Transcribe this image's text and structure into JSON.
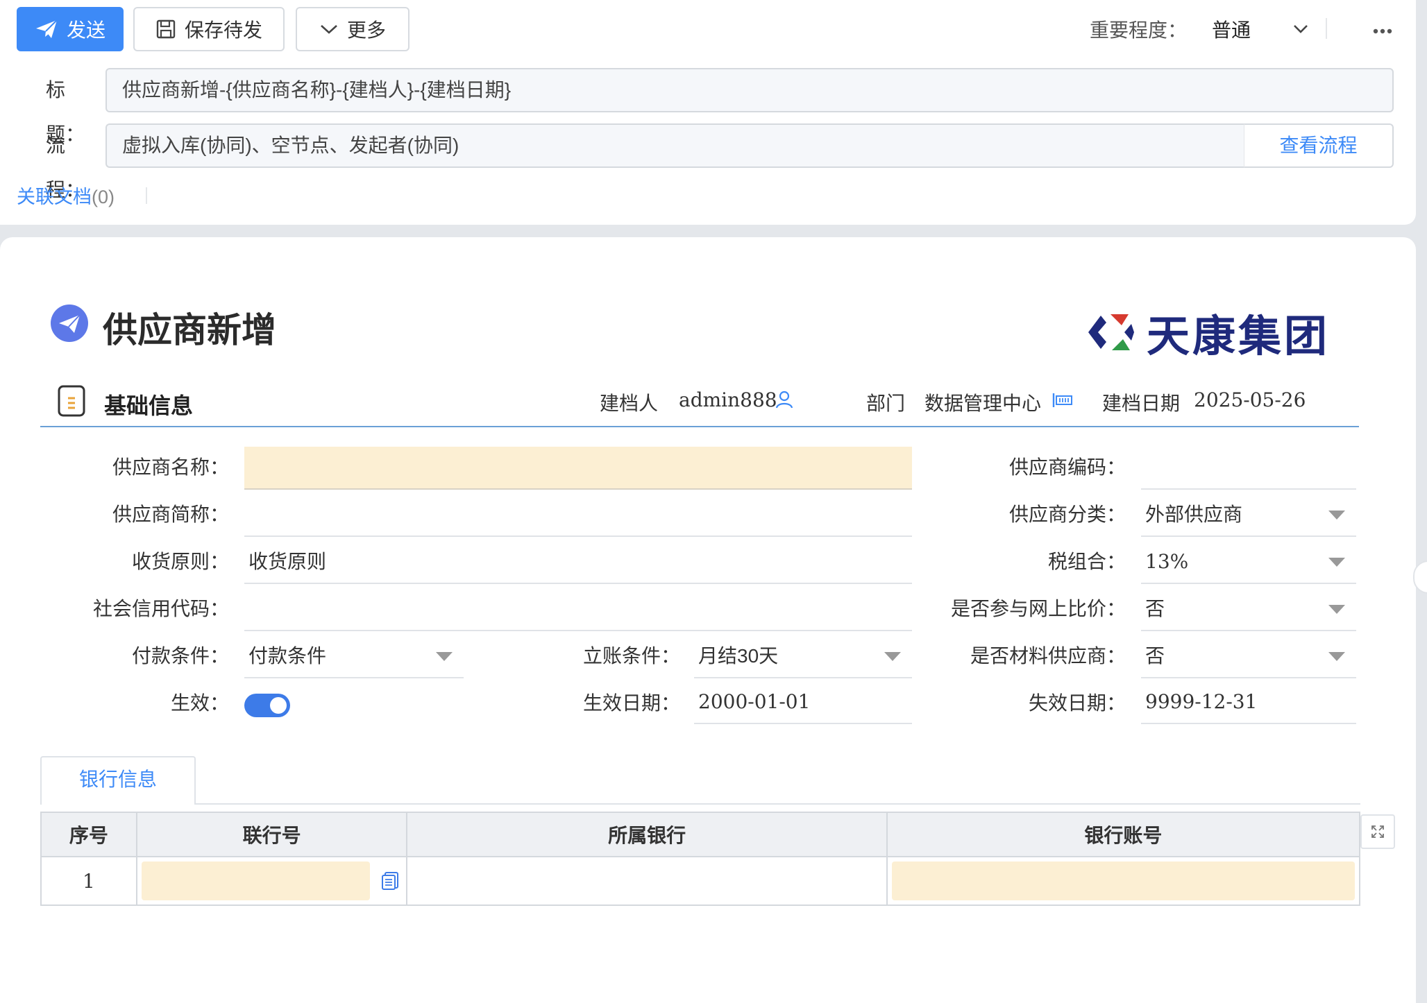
{
  "toolbar": {
    "send_label": "发送",
    "save_label": "保存待发",
    "more_label": "更多",
    "importance_label": "重要程度：",
    "importance_value": "普通"
  },
  "header": {
    "title_label": "标题：",
    "title_value": "供应商新增-{供应商名称}-{建档人}-{建档日期}",
    "flow_label": "流程：",
    "flow_value": "虚拟入库(协同)、空节点、发起者(协同)",
    "view_flow_label": "查看流程",
    "related_docs_label": "关联文档",
    "related_docs_count": "(0)"
  },
  "form": {
    "title": "供应商新增",
    "brand": "天康集团",
    "section_title": "基础信息",
    "meta": {
      "creator_label": "建档人",
      "creator_value": "admin888",
      "dept_label": "部门",
      "dept_value": "数据管理中心",
      "date_label": "建档日期",
      "date_value": "2025-05-26"
    },
    "fields": {
      "supplier_name_label": "供应商名称：",
      "supplier_name_value": "",
      "supplier_code_label": "供应商编码：",
      "supplier_code_value": "",
      "supplier_short_label": "供应商简称：",
      "supplier_short_value": "",
      "supplier_category_label": "供应商分类：",
      "supplier_category_value": "外部供应商",
      "receipt_rule_label": "收货原则：",
      "receipt_rule_value": "收货原则",
      "tax_group_label": "税组合：",
      "tax_group_value": "13%",
      "credit_code_label": "社会信用代码：",
      "credit_code_value": "",
      "online_bid_label": "是否参与网上比价：",
      "online_bid_value": "否",
      "payment_terms_label": "付款条件：",
      "payment_terms_value": "付款条件",
      "billing_terms_label": "立账条件：",
      "billing_terms_value": "月结30天",
      "material_supplier_label": "是否材料供应商：",
      "material_supplier_value": "否",
      "effective_label": "生效：",
      "effective_on": true,
      "effective_date_label": "生效日期：",
      "effective_date_value": "2000-01-01",
      "expiry_date_label": "失效日期：",
      "expiry_date_value": "9999-12-31"
    },
    "bank_tab_label": "银行信息",
    "bank_table": {
      "columns": [
        "序号",
        "联行号",
        "所属银行",
        "银行账号"
      ],
      "rows": [
        {
          "index": "1",
          "bank_code": "",
          "bank_name": "",
          "account": ""
        }
      ]
    }
  },
  "colors": {
    "accent": "#3d8af7",
    "required_fill": "#fcefd3",
    "brand_text": "#1f2a7c",
    "toggle_on": "#3d7be8"
  }
}
